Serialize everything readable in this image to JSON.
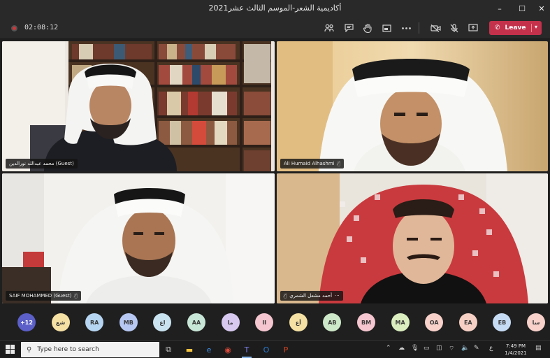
{
  "window": {
    "title": "أكاديمية الشعر-الموسم الثالث عشر2021",
    "controls": {
      "minimize": "–",
      "maximize": "☐",
      "close": "✕"
    }
  },
  "toolbar": {
    "timer": "02:08:12",
    "leave_label": "Leave",
    "icons": [
      "people-icon",
      "chat-icon",
      "raise-hand-icon",
      "share-tray-icon",
      "more-icon",
      "camera-off-icon",
      "mic-off-icon",
      "share-icon"
    ]
  },
  "participants": [
    {
      "name": "محمد عبدالله نورالدين (Guest)"
    },
    {
      "name": "Ali Humaid Alhashmi"
    },
    {
      "name": "SAIF MOHAMMED (Guest)"
    },
    {
      "name": "أحمد مشعل الشمري"
    }
  ],
  "avatars": [
    {
      "label": "+12",
      "color": "#5b5fc7"
    },
    {
      "label": "شع",
      "color": "#f5e1a4"
    },
    {
      "label": "RA",
      "color": "#b6d5f2"
    },
    {
      "label": "MB",
      "color": "#b6c8f2"
    },
    {
      "label": "اع",
      "color": "#c9e3f0"
    },
    {
      "label": "AA",
      "color": "#c8e6d7"
    },
    {
      "label": "ما",
      "color": "#d7c9f0"
    },
    {
      "label": "II",
      "color": "#f5c6cf"
    },
    {
      "label": "أع",
      "color": "#f5e1a4"
    },
    {
      "label": "AB",
      "color": "#cde8c8"
    },
    {
      "label": "BM",
      "color": "#f5c6cf"
    },
    {
      "label": "MA",
      "color": "#dbeec0"
    },
    {
      "label": "OA",
      "color": "#f8d1cb"
    },
    {
      "label": "EA",
      "color": "#f6d0c4"
    },
    {
      "label": "EB",
      "color": "#c6dcf5"
    },
    {
      "label": "سا",
      "color": "#f8d1cb"
    }
  ],
  "taskbar": {
    "search_placeholder": "Type here to search",
    "time": "7:49 PM",
    "date": "1/4/2021"
  }
}
